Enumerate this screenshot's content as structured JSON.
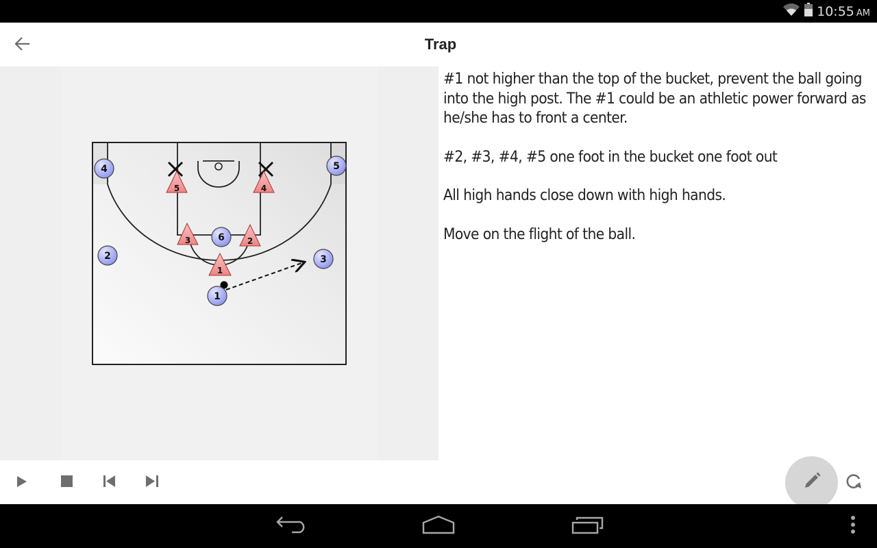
{
  "status_bar": {
    "time": "10:55",
    "ampm": "AM",
    "icons": [
      "wifi-icon",
      "battery-icon"
    ]
  },
  "app_bar": {
    "back_icon": "arrow-left-icon",
    "title": "Trap"
  },
  "diagram": {
    "offense_color": "#9da3f5",
    "defense_color": "#f08f8f",
    "offense_players": [
      {
        "label": "4",
        "position": "left-corner"
      },
      {
        "label": "5",
        "position": "right-corner"
      },
      {
        "label": "6",
        "position": "high-post"
      },
      {
        "label": "2",
        "position": "left-wing"
      },
      {
        "label": "3",
        "position": "right-wing"
      },
      {
        "label": "1",
        "position": "top-of-key",
        "has_ball": true
      }
    ],
    "defense_players": [
      {
        "label": "5",
        "position": "left-block"
      },
      {
        "label": "4",
        "position": "right-block"
      },
      {
        "label": "3",
        "position": "left-elbow"
      },
      {
        "label": "2",
        "position": "right-elbow"
      },
      {
        "label": "1",
        "position": "top-of-circle"
      }
    ],
    "markers": [
      "x-mark-left-block",
      "x-mark-right-block"
    ],
    "actions": [
      {
        "type": "pass",
        "from": "1",
        "to": "3",
        "style": "dashed-arrow"
      }
    ]
  },
  "notes": {
    "paragraphs": [
      "#1 not higher than the top of the bucket, prevent the ball going into the high post. The #1 could be an athletic power forward as he/she has to front a center.",
      "#2, #3, #4, #5 one foot in the bucket one foot out",
      "All high hands close down with high hands.",
      "Move on the flight of the ball."
    ]
  },
  "playback": {
    "play": "play-icon",
    "stop": "stop-icon",
    "previous": "skip-previous-icon",
    "next": "skip-next-icon",
    "edit": "pencil-icon",
    "replay": "replay-icon"
  },
  "nav_bar": {
    "back": "nav-back-icon",
    "home": "nav-home-icon",
    "recents": "nav-recents-icon",
    "menu": "overflow-menu-icon"
  }
}
